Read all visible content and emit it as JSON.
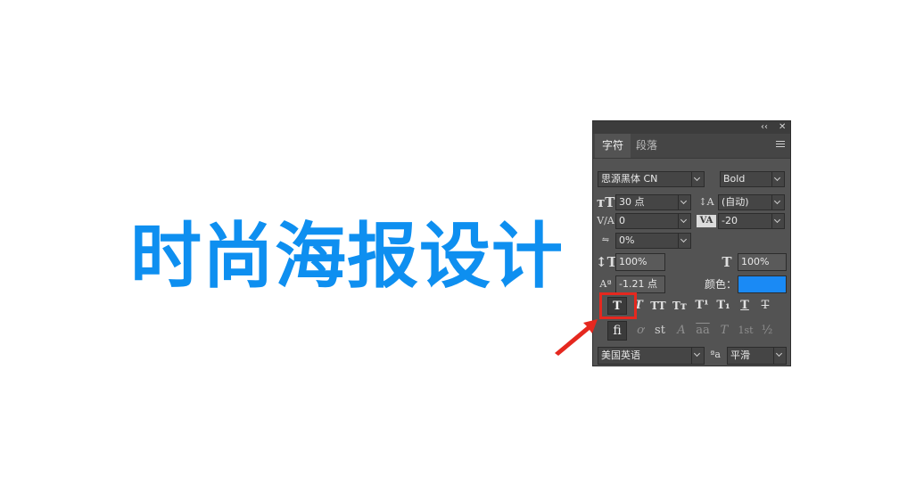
{
  "headline": {
    "text": "时尚海报设计",
    "color": "#0e8ff0"
  },
  "panel": {
    "controls": {
      "collapse": "‹‹",
      "close": "✕"
    },
    "tabs": [
      {
        "label": "字符",
        "active": true
      },
      {
        "label": "段落",
        "active": false
      }
    ],
    "font_family": "思源黑体 CN",
    "font_style": "Bold",
    "font_size": "30 点",
    "leading": "(自动)",
    "kerning": "0",
    "tracking": "-20",
    "vertical_scale_percent": "0%",
    "vertical_scale": "100%",
    "horizontal_scale": "100%",
    "baseline_shift": "-1.21 点",
    "color_label": "颜色：",
    "text_color": "#1a8af5",
    "style_buttons": [
      "T",
      "T",
      "TT",
      "Tт",
      "T¹",
      "T₁",
      "T",
      "T"
    ],
    "opentype_buttons": [
      "fi",
      "ơ",
      "st",
      "A",
      "aa",
      "T",
      "1st",
      "½"
    ],
    "language": "美国英语",
    "antialias_icon": "ªa",
    "antialias": "平滑"
  },
  "highlight_color": "#e5281f"
}
